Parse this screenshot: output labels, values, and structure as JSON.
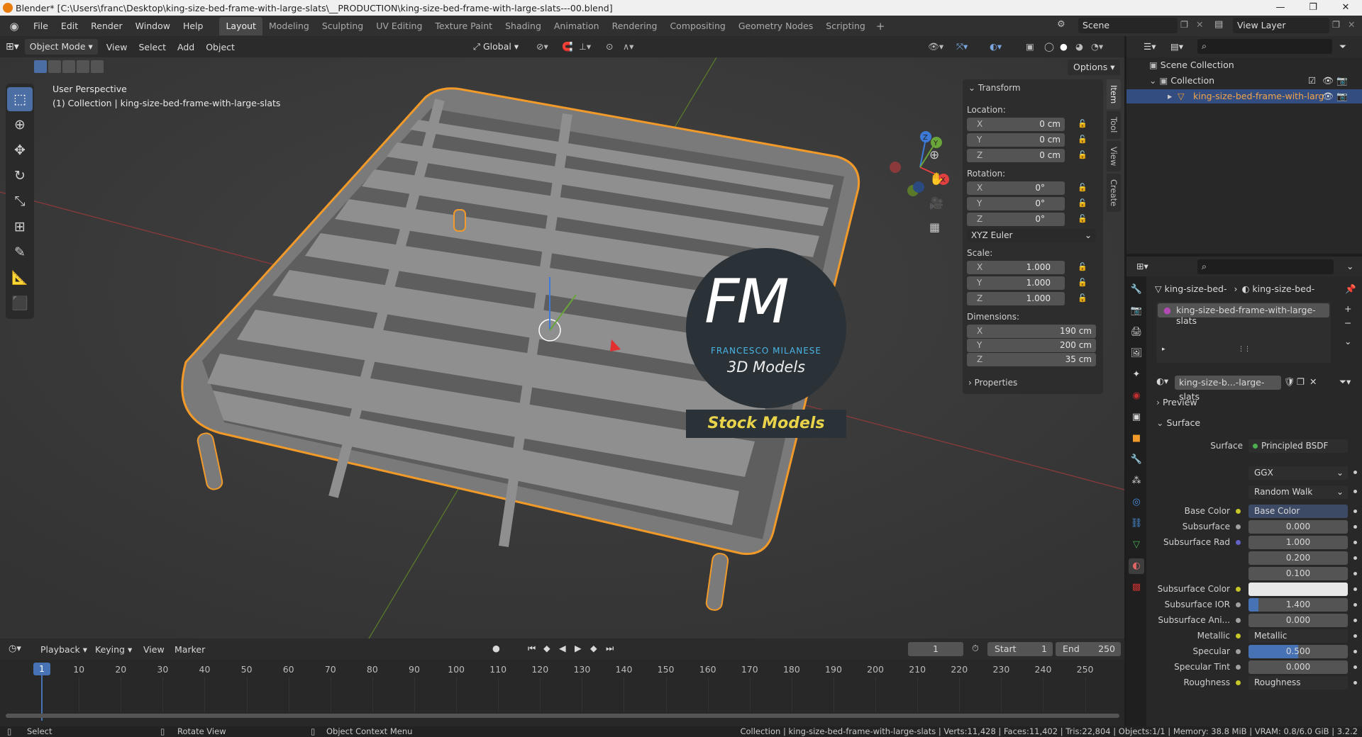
{
  "titlebar": {
    "title": "Blender* [C:\\Users\\franc\\Desktop\\king-size-bed-frame-with-large-slats\\__PRODUCTION\\king-size-bed-frame-with-large-slats---00.blend]"
  },
  "menu": [
    "File",
    "Edit",
    "Render",
    "Window",
    "Help"
  ],
  "workspaces": [
    "Layout",
    "Modeling",
    "Sculpting",
    "UV Editing",
    "Texture Paint",
    "Shading",
    "Animation",
    "Rendering",
    "Compositing",
    "Geometry Nodes",
    "Scripting"
  ],
  "scene": {
    "name": "Scene",
    "view_layer": "View Layer"
  },
  "header": {
    "mode": "Object Mode",
    "menus": [
      "View",
      "Select",
      "Add",
      "Object"
    ],
    "orientation": "Global",
    "options": "Options"
  },
  "viewport": {
    "perspective": "User Perspective",
    "collection_line": "(1) Collection | king-size-bed-frame-with-large-slats",
    "watermark": {
      "initials": "FM",
      "brand": "FRANCESCO MILANESE",
      "sub": "3D Models",
      "banner": "Stock Models"
    },
    "gizmo": {
      "x": "X",
      "y": "Y",
      "z": "Z"
    }
  },
  "npanel": {
    "tabs": [
      "Item",
      "Tool",
      "View",
      "Create"
    ],
    "transform_title": "Transform",
    "location_label": "Location:",
    "location": [
      {
        "axis": "X",
        "value": "0 cm"
      },
      {
        "axis": "Y",
        "value": "0 cm"
      },
      {
        "axis": "Z",
        "value": "0 cm"
      }
    ],
    "rotation_label": "Rotation:",
    "rotation": [
      {
        "axis": "X",
        "value": "0°"
      },
      {
        "axis": "Y",
        "value": "0°"
      },
      {
        "axis": "Z",
        "value": "0°"
      }
    ],
    "rotation_mode": "XYZ Euler",
    "scale_label": "Scale:",
    "scale": [
      {
        "axis": "X",
        "value": "1.000"
      },
      {
        "axis": "Y",
        "value": "1.000"
      },
      {
        "axis": "Z",
        "value": "1.000"
      }
    ],
    "dimensions_label": "Dimensions:",
    "dimensions": [
      {
        "axis": "X",
        "value": "190 cm"
      },
      {
        "axis": "Y",
        "value": "200 cm"
      },
      {
        "axis": "Z",
        "value": "35 cm"
      }
    ],
    "properties_title": "Properties"
  },
  "outliner": {
    "scene_collection": "Scene Collection",
    "collection": "Collection",
    "object": "king-size-bed-frame-with-larg"
  },
  "properties": {
    "breadcrumb_object": "king-size-bed-",
    "breadcrumb_material": "king-size-bed-",
    "material_slot": "king-size-bed-frame-with-large-slats",
    "material_name": "king-size-b...-large-slats",
    "preview": "Preview",
    "surface_panel": "Surface",
    "surface_label": "Surface",
    "surface_value": "Principled BSDF",
    "distribution": "GGX",
    "subsurface_method": "Random Walk",
    "inputs": [
      {
        "label": "Base Color",
        "value": "Base Color",
        "kind": "link"
      },
      {
        "label": "Subsurface",
        "value": "0.000",
        "kind": "num"
      },
      {
        "label": "Subsurface Rad",
        "value": "1.000",
        "kind": "num"
      },
      {
        "label": "",
        "value": "0.200",
        "kind": "num"
      },
      {
        "label": "",
        "value": "0.100",
        "kind": "num"
      },
      {
        "label": "Subsurface Color",
        "value": "",
        "kind": "color"
      },
      {
        "label": "Subsurface IOR",
        "value": "1.400",
        "kind": "num"
      },
      {
        "label": "Subsurface Ani...",
        "value": "0.000",
        "kind": "num"
      },
      {
        "label": "Metallic",
        "value": "Metallic",
        "kind": "link"
      },
      {
        "label": "Specular",
        "value": "0.500",
        "kind": "bar"
      },
      {
        "label": "Specular Tint",
        "value": "0.000",
        "kind": "num"
      },
      {
        "label": "Roughness",
        "value": "Roughness",
        "kind": "link"
      }
    ]
  },
  "timeline": {
    "menus": [
      "Playback",
      "Keying",
      "View",
      "Marker"
    ],
    "current_frame": "1",
    "start_label": "Start",
    "start": "1",
    "end_label": "End",
    "end": "250",
    "ticks": [
      "1",
      "10",
      "20",
      "30",
      "40",
      "50",
      "60",
      "70",
      "80",
      "90",
      "100",
      "110",
      "120",
      "130",
      "140",
      "150",
      "160",
      "170",
      "180",
      "190",
      "200",
      "210",
      "220",
      "230",
      "240",
      "250"
    ]
  },
  "statusbar": {
    "select": "Select",
    "rotate": "Rotate View",
    "context": "Object Context Menu",
    "stats": "Collection | king-size-bed-frame-with-large-slats | Verts:11,428 | Faces:11,402 | Tris:22,804 | Objects:1/1 | Memory: 38.8 MiB | VRAM: 0.8/6.0 GiB | 3.2.2"
  },
  "colors": {
    "accent": "#4772b3",
    "selection": "#f19a2a",
    "active_tab": "#4b6fa5"
  }
}
